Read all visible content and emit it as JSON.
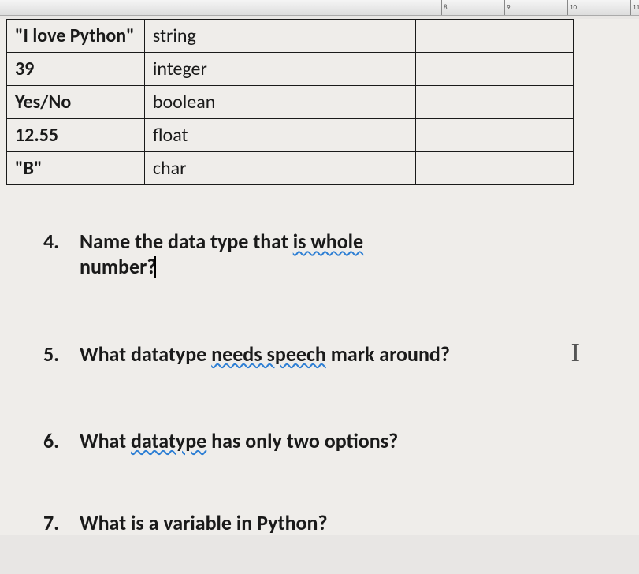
{
  "ruler": {
    "marks": [
      "8",
      "9",
      "10",
      "11"
    ]
  },
  "table": {
    "rows": [
      {
        "value": "\"I love Python\"",
        "type": "string"
      },
      {
        "value": "39",
        "type": "integer"
      },
      {
        "value": "Yes/No",
        "type": "boolean"
      },
      {
        "value": "12.55",
        "type": "float"
      },
      {
        "value": "\"B\"",
        "type": "char"
      }
    ]
  },
  "questions": {
    "q4": {
      "num": "4.",
      "pre": "Name the data type that ",
      "sq": "is whole",
      "post": " number?"
    },
    "q5": {
      "num": "5.",
      "pre": "What datatype ",
      "sq": "needs speech",
      "post": " mark around?"
    },
    "q6": {
      "num": "6.",
      "pre": "What ",
      "sq": "datatype",
      "post": " has only two options?"
    },
    "q7": {
      "num": "7.",
      "text": "What is a variable in Python?"
    }
  }
}
